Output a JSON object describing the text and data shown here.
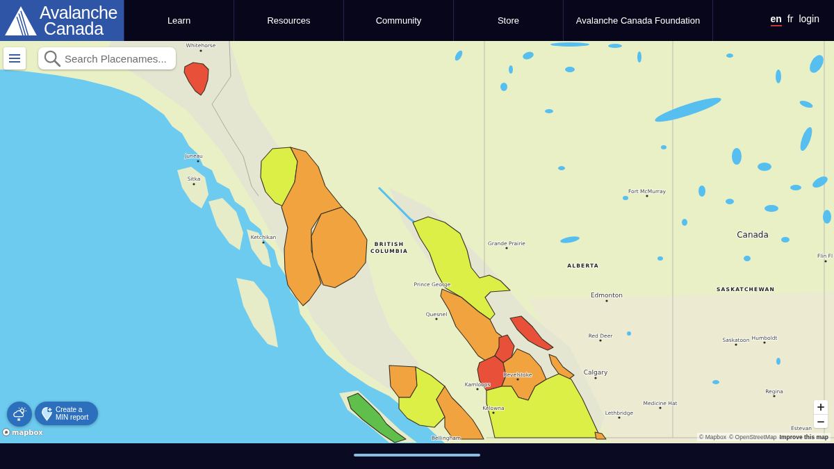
{
  "header": {
    "logo": {
      "title": "Avalanche",
      "subtitle": "Canada"
    },
    "nav": [
      "Learn",
      "Resources",
      "Community",
      "Store",
      "Avalanche Canada Foundation"
    ],
    "languages": [
      {
        "label": "en",
        "selected": true
      },
      {
        "label": "fr",
        "selected": false
      }
    ],
    "login": "login"
  },
  "map": {
    "search": {
      "placeholder": "Search Placenames..."
    },
    "regions": [
      {
        "color": "#e8503a"
      },
      {
        "color": "#dcef47"
      },
      {
        "color": "#f0a33e"
      },
      {
        "color": "#f0a33e"
      },
      {
        "color": "#dcef47"
      },
      {
        "color": "#f0a33e"
      },
      {
        "color": "#e8503a"
      },
      {
        "color": "#e8503a"
      },
      {
        "color": "#f0a33e"
      },
      {
        "color": "#e8503a"
      },
      {
        "color": "#f0a33e"
      },
      {
        "color": "#dcef47"
      },
      {
        "color": "#f0a33e"
      },
      {
        "color": "#dcef47"
      },
      {
        "color": "#f0a33e"
      },
      {
        "color": "#5fbf4a"
      },
      {
        "color": "#f0a33e"
      }
    ],
    "labels": [
      {
        "text": "Whitehorse",
        "kind": "city"
      },
      {
        "text": "Juneau",
        "kind": "city"
      },
      {
        "text": "Sitka",
        "kind": "city"
      },
      {
        "text": "Ketchikan",
        "kind": "city"
      },
      {
        "text": "BRITISH COLUMBIA",
        "kind": "province"
      },
      {
        "text": "Prince George",
        "kind": "city"
      },
      {
        "text": "Quesnel",
        "kind": "city"
      },
      {
        "text": "Grande Prairie",
        "kind": "city"
      },
      {
        "text": "Fort McMurray",
        "kind": "city"
      },
      {
        "text": "ALBERTA",
        "kind": "province"
      },
      {
        "text": "Edmonton",
        "kind": "major_city"
      },
      {
        "text": "Red Deer",
        "kind": "city"
      },
      {
        "text": "Calgary",
        "kind": "major_city"
      },
      {
        "text": "Kamloops",
        "kind": "city"
      },
      {
        "text": "Revelstoke",
        "kind": "city"
      },
      {
        "text": "Kelowna",
        "kind": "city"
      },
      {
        "text": "Medicine Hat",
        "kind": "city"
      },
      {
        "text": "Lethbridge",
        "kind": "city"
      },
      {
        "text": "Canada",
        "kind": "country"
      },
      {
        "text": "SASKATCHEWAN",
        "kind": "province"
      },
      {
        "text": "Saskatoon",
        "kind": "city"
      },
      {
        "text": "Humboldt",
        "kind": "city"
      },
      {
        "text": "Regina",
        "kind": "city"
      },
      {
        "text": "Estevan",
        "kind": "city"
      },
      {
        "text": "Flin Fl",
        "kind": "city"
      },
      {
        "text": "Bellingham",
        "kind": "city"
      }
    ],
    "report_button": "Create a MIN report",
    "zoom_in": "+",
    "zoom_out": "−",
    "logo": "mapbox",
    "attribution": [
      {
        "text": "© Mapbox",
        "kind": "link"
      },
      {
        "text": "© OpenStreetMap",
        "kind": "link"
      },
      {
        "text": "Improve this map",
        "kind": "emphasis"
      }
    ]
  }
}
